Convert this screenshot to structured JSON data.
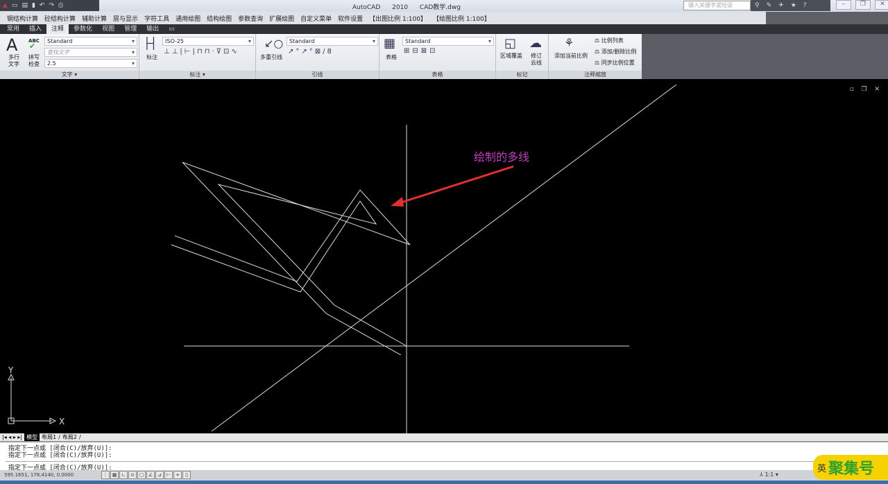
{
  "titlebar": {
    "app": "AutoCAD 2010",
    "file": "CAD教学.dwg",
    "search_placeholder": "键入关键字或短语"
  },
  "menubar": [
    "钢结构计算",
    "砼结构计算",
    "辅助计算",
    "层与显示",
    "字符工具",
    "通用绘图",
    "结构绘图",
    "参数查询",
    "扩展绘图",
    "自定义菜单",
    "软件设置",
    "【出图比例 1:100】",
    "【绘图比例 1:100】"
  ],
  "tabs": [
    "常用",
    "插入",
    "注释",
    "参数化",
    "视图",
    "管理",
    "输出",
    "▭"
  ],
  "active_tab": "注释",
  "ribbon": {
    "text_panel": {
      "mtext": "多行",
      "mtext2": "文字",
      "spell_abc": "ABC",
      "spell": "拼写",
      "spell2": "检查",
      "style": "Standard",
      "find_placeholder": "查找文字",
      "height": "2.5",
      "label": "文字 ▾"
    },
    "dim_panel": {
      "dim": "标注",
      "style": "ISO-25",
      "label": "标注 ▾"
    },
    "leader_panel": {
      "mleader": "多重引线",
      "style": "Standard",
      "label": "引线"
    },
    "table_panel": {
      "table": "表格",
      "style": "Standard",
      "label": "表格"
    },
    "markup_panel": {
      "wipeout": "区域覆盖",
      "revcloud": "修订",
      "revcloud2": "云线",
      "label": "标记"
    },
    "scale_panel": {
      "add_scale": "添加当前比例",
      "list": "比例列表",
      "add_delete": "添加/删除比例",
      "sync": "同步比例位置",
      "label": "注释缩放"
    }
  },
  "drawing": {
    "annotation": "绘制的多线",
    "annotation_color": "#c040c0",
    "arrow_color": "#e03030",
    "ucs_x": "X",
    "ucs_y": "Y"
  },
  "layout_tabs": [
    "模型",
    "布局1",
    "布局2"
  ],
  "command_lines": [
    "指定下一点或 [闭合(C)/放弃(U)]:",
    "指定下一点或 [闭合(C)/放弃(U)]:",
    "指定下一点或 [闭合(C)/放弃(U)]:"
  ],
  "status": {
    "coords": "595.1651, 178.4140, 0.0000",
    "scale": "1:1"
  },
  "watermark": {
    "en": "英",
    "brand": "聚集号"
  }
}
